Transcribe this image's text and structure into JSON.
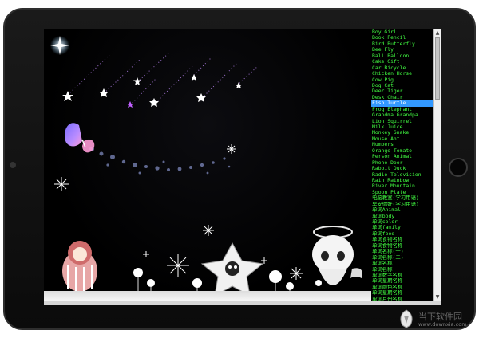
{
  "listbox": {
    "items": [
      "Boy Girl",
      "Book Pencil",
      "Bird Butterfly",
      "Bee Fly",
      "Ball Balloon",
      "Cake Gift",
      "Car Bicycle",
      "Chicken Horse",
      "Cow Pig",
      "Dog Cat",
      "Deer Tiger",
      "Desk Chair",
      "Fish Turtle",
      "Frog Elephant",
      "Grandma Grandpa",
      "Lion Squirrel",
      "Milk Juice",
      "Monkey Snake",
      "Mouse Ant",
      "Numbers",
      "Orange Tomato",
      "Person Animal",
      "Phone Door",
      "Rabbit Duck",
      "Radio Television",
      "Rain Rainbow",
      "River Mountain",
      "Spoon Plate",
      "电脑教室(学习用语)",
      "早安你好(学习用语)",
      "单词Animal",
      "单词body",
      "单词color",
      "单词family",
      "单词food",
      "单词食物名称",
      "单词食物名称",
      "单词名称(一)",
      "单词名称(二)",
      "单词名称",
      "单词名称",
      "单词数字名称",
      "单词星期名称",
      "单词颜色名称",
      "单词星期名称",
      "单词月份名称"
    ],
    "selected_index": 12,
    "text_color": "#42ff42",
    "selected_bg": "#3399ff"
  },
  "scrollbar": {
    "up_arrow": "▲",
    "down_arrow": "▼"
  },
  "watermark": {
    "title": "当下软件园",
    "subtitle": "www.downxia.com"
  },
  "colors": {
    "screen_bg": "#000000",
    "frame": "#111111",
    "star_trail": "#d9a0ff"
  }
}
